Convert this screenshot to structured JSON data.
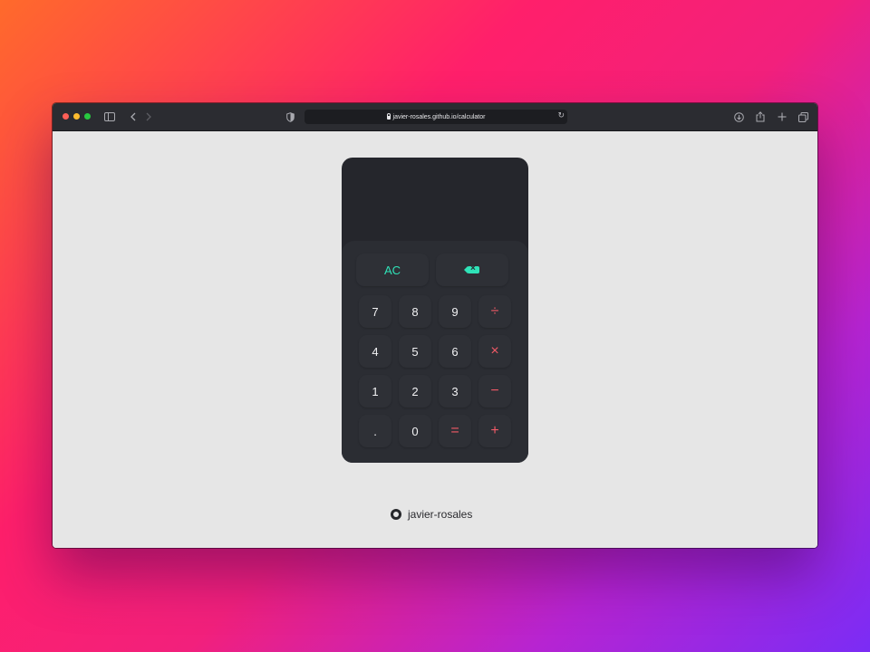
{
  "browser": {
    "url": "javier-rosales.github.io/calculator",
    "icons": {
      "sidebar": "sidebar-icon",
      "back": "chevron-left-icon",
      "forward": "chevron-right-icon",
      "shield": "shield-icon",
      "reload": "reload-icon",
      "download": "download-icon",
      "share": "share-icon",
      "new_tab": "plus-icon",
      "tabs": "tabs-overview-icon"
    }
  },
  "calculator": {
    "display": "",
    "keys": {
      "clear": "AC",
      "backspace_icon": "backspace-icon",
      "seven": "7",
      "eight": "8",
      "nine": "9",
      "divide": "÷",
      "four": "4",
      "five": "5",
      "six": "6",
      "multiply": "×",
      "one": "1",
      "two": "2",
      "three": "3",
      "subtract": "−",
      "decimal": ".",
      "zero": "0",
      "equals": "=",
      "add": "+"
    },
    "colors": {
      "accent_green": "#2fe3b8",
      "accent_red": "#f15a67",
      "body": "#25262c",
      "keypad": "#2b2d33"
    }
  },
  "footer": {
    "icon": "github-icon",
    "username": "javier-rosales"
  }
}
